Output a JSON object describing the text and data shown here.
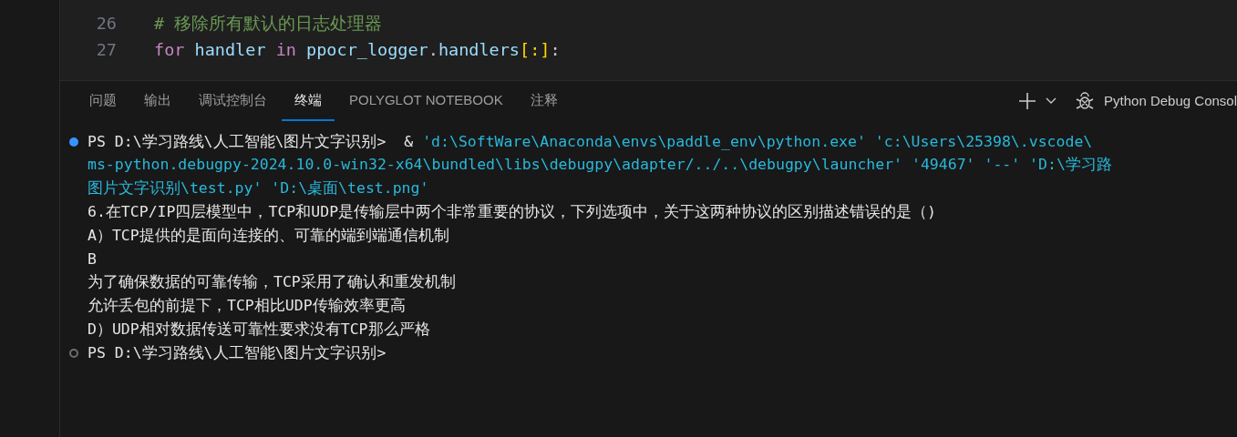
{
  "editor": {
    "lines": [
      {
        "number": "26",
        "tokens": [
          {
            "kind": "comment",
            "text": "# 移除所有默认的日志处理器"
          }
        ]
      },
      {
        "number": "27",
        "tokens": [
          {
            "kind": "keyword",
            "text": "for"
          },
          {
            "kind": "variable",
            "text": " handler "
          },
          {
            "kind": "keyword",
            "text": "in"
          },
          {
            "kind": "variable",
            "text": " ppocr_logger"
          },
          {
            "kind": "plain",
            "text": "."
          },
          {
            "kind": "variable",
            "text": "handlers"
          },
          {
            "kind": "bracket",
            "text": "[:]"
          },
          {
            "kind": "plain",
            "text": ":"
          }
        ]
      }
    ]
  },
  "panel": {
    "tabs": [
      {
        "label": "问题",
        "selected": false
      },
      {
        "label": "输出",
        "selected": false
      },
      {
        "label": "调试控制台",
        "selected": false
      },
      {
        "label": "终端",
        "selected": true
      },
      {
        "label": "POLYGLOT NOTEBOOK",
        "selected": false
      },
      {
        "label": "注释",
        "selected": false
      }
    ],
    "terminal_name": "Python Debug Consol"
  },
  "terminal": {
    "lines": [
      {
        "kind": "command",
        "finished": true,
        "segments": [
          {
            "kind": "prompt",
            "text": "PS D:\\学习路线\\人工智能\\图片文字识别>  & "
          },
          {
            "kind": "arg",
            "text": "'d:\\SoftWare\\Anaconda\\envs\\paddle_env\\python.exe' 'c:\\Users\\25398\\.vscode\\"
          }
        ]
      },
      {
        "kind": "output",
        "segments": [
          {
            "kind": "arg",
            "text": "ms-python.debugpy-2024.10.0-win32-x64\\bundled\\libs\\debugpy\\adapter/../..\\debugpy\\launcher' '49467' '--' 'D:\\学习路"
          }
        ]
      },
      {
        "kind": "output",
        "segments": [
          {
            "kind": "arg",
            "text": "图片文字识别\\test.py' 'D:\\桌面\\test.png'"
          }
        ]
      },
      {
        "kind": "output",
        "segments": [
          {
            "kind": "output",
            "text": "6.在TCP/IP四层模型中，TCP和UDP是传输层中两个非常重要的协议，下列选项中，关于这两种协议的区别描述错误的是（)"
          }
        ]
      },
      {
        "kind": "output",
        "segments": [
          {
            "kind": "output",
            "text": "A）TCP提供的是面向连接的、可靠的端到端通信机制"
          }
        ]
      },
      {
        "kind": "output",
        "segments": [
          {
            "kind": "output",
            "text": "B"
          }
        ]
      },
      {
        "kind": "output",
        "segments": [
          {
            "kind": "output",
            "text": "为了确保数据的可靠传输，TCP采用了确认和重发机制"
          }
        ]
      },
      {
        "kind": "output",
        "segments": [
          {
            "kind": "output",
            "text": "允许丢包的前提下，TCP相比UDP传输效率更高"
          }
        ]
      },
      {
        "kind": "output",
        "segments": [
          {
            "kind": "output",
            "text": "D）UDP相对数据传送可靠性要求没有TCP那么严格"
          }
        ]
      },
      {
        "kind": "command",
        "finished": false,
        "segments": [
          {
            "kind": "prompt",
            "text": "PS D:\\学习路线\\人工智能\\图片文字识别>"
          }
        ]
      }
    ]
  }
}
